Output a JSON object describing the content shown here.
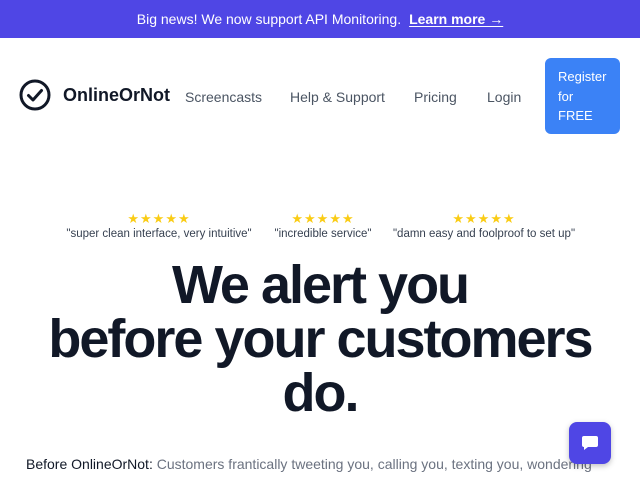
{
  "announcement": {
    "message": "Big news! We now support API Monitoring.",
    "link_label": "Learn more →"
  },
  "header": {
    "brand": "OnlineOrNot",
    "logo_icon": "check-circle-icon",
    "nav": {
      "screencasts": "Screencasts",
      "help": "Help & Support",
      "pricing": "Pricing",
      "login": "Login"
    },
    "register": {
      "line1": "Register",
      "line2": "for",
      "line3": "FREE"
    }
  },
  "reviews": [
    {
      "stars": "★★★★★",
      "rating": 5,
      "quote": "\"super clean interface, very intuitive\""
    },
    {
      "stars": "★★★★★",
      "rating": 5,
      "quote": "\"incredible service\""
    },
    {
      "stars": "★★★★★",
      "rating": 5,
      "quote": "\"damn easy and foolproof to set up\""
    }
  ],
  "hero": {
    "line1": "We alert you",
    "line2": "before your customers",
    "line3": "do."
  },
  "before": {
    "label": "Before OnlineOrNot:",
    "text": " Customers frantically tweeting you, calling you, texting you, wondering"
  },
  "chat_widget": {
    "icon": "chat-bubble-icon"
  },
  "colors": {
    "announcement_bg": "#4f46e5",
    "register_bg": "#3b82f6",
    "star": "#facc15",
    "chat_bg": "#4f46e5"
  }
}
